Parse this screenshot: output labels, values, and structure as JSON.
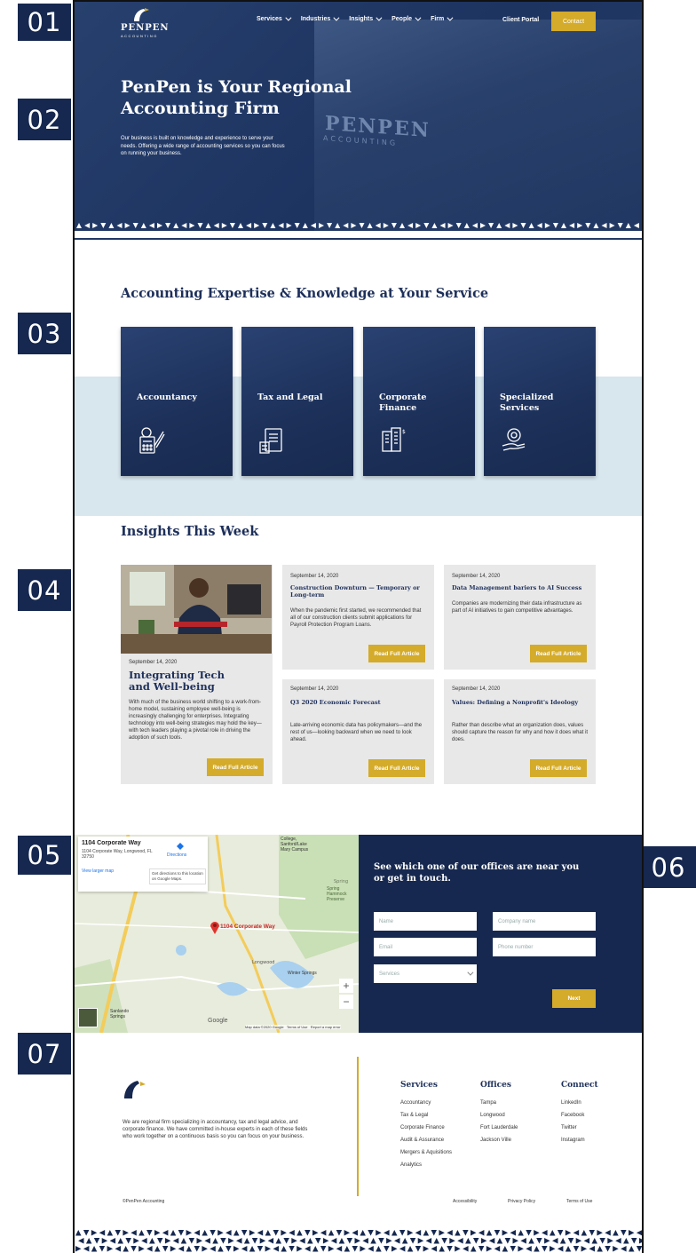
{
  "badges": {
    "b1": "01",
    "b2": "02",
    "b3": "03",
    "b4": "04",
    "b5": "05",
    "b6": "06",
    "b7": "07"
  },
  "brand": {
    "name": "PENPEN",
    "sub": "ACCOUNTING",
    "accent": "#d4ab2a",
    "navy": "#16284f"
  },
  "nav": {
    "items": [
      "Services",
      "Industries",
      "Insights",
      "People",
      "Firm"
    ],
    "portal": "Client Portal",
    "contact": "Contact"
  },
  "hero": {
    "title": "PenPen is Your Regional Accounting Firm",
    "text": "Our business is built on knowledge and experience to serve your needs. Offering a wide range of accounting services so you can focus on running your business.",
    "sign": "PENPEN",
    "sign_sub": "ACCOUNTING"
  },
  "expertise": {
    "title": "Accounting Expertise & Knowledge at Your Service",
    "cards": [
      {
        "label": "Accountancy",
        "icon": "calculator-icon"
      },
      {
        "label": "Tax and Legal",
        "icon": "tax-document-icon"
      },
      {
        "label": "Corporate Finance",
        "icon": "building-finance-icon"
      },
      {
        "label": "Specialized Services",
        "icon": "hand-gear-icon"
      }
    ]
  },
  "insights": {
    "title": "Insights This Week",
    "featured": {
      "date": "September 14, 2020",
      "title": "Integrating Tech and Well-being",
      "body": "With much of the business world shifting to a work-from-home model, sustaining employee well-being is increasingly challenging for enterprises. Integrating technology into well-being strategies may hold the key—with tech leaders playing a pivotal role in driving the adoption of such tools.",
      "button": "Read Full Article"
    },
    "articles": [
      {
        "date": "September 14, 2020",
        "title": "Construction Downturn — Temporary or Long-term",
        "body": "When the pandemic first started, we recommended that all of our construction clients submit applications for Payroll Protection Program Loans.",
        "button": "Read Full Article"
      },
      {
        "date": "September 14, 2020",
        "title": "Data Management bariers to AI Success",
        "body": "Companies are modernizing their data infrastructure as part of AI initiatives to gain competitive advantages.",
        "button": "Read Full Article"
      },
      {
        "date": "September 14, 2020",
        "title": "Q3 2020 Economic Forecast",
        "body": "Late-arriving economic data has policymakers—and the rest of us—looking backward when we need to look ahead.",
        "button": "Read Full Article"
      },
      {
        "date": "September 14, 2020",
        "title": "Values: Defining a Nonprofit's Ideology",
        "body": "Rather than describe what an organization does, values should capture the reason for why and how it does what it does.",
        "button": "Read Full Article"
      }
    ]
  },
  "map": {
    "place": "1104 Corporate Way",
    "address": "1104 Corporate Way, Longwood, FL 32750",
    "directions": "Directions",
    "larger": "View larger map",
    "hint": "Get directions to this location on Google Maps.",
    "pin_label": "1104 Corporate Way",
    "labels": {
      "college": "College, Sanford/Lake Mary Campus",
      "spring": "Spring Hammock Preserve",
      "longwood": "Longwood",
      "winter": "Winter Springs",
      "sanlando": "Sanlando Springs"
    },
    "attribution": "Map data ©2020 Google   Terms of Use   Report a map error",
    "google": "Google",
    "zoom_in": "+",
    "zoom_out": "−"
  },
  "form": {
    "title": "See which one of our offices are near you or get in touch.",
    "name": "Name",
    "company": "Company name",
    "email": "Email",
    "phone": "Phone number",
    "services": "Services",
    "next": "Next"
  },
  "footer": {
    "desc": "We are regional firm specializing in accountancy, tax and legal advice, and corporate finance. We have committed in-house experts in each of these fields who work together on a continuous basis so you can focus on your business.",
    "services": {
      "title": "Services",
      "items": [
        "Accountancy",
        "Tax & Legal",
        "Corporate Finance",
        "Audit & Assurance",
        "Mergers & Aquisitions",
        "Analytics"
      ]
    },
    "offices": {
      "title": "Offices",
      "items": [
        "Tampa",
        "Longwood",
        "Fort Lauderdale",
        "Jackson Ville"
      ]
    },
    "connect": {
      "title": "Connect",
      "items": [
        "LinkedIn",
        "Facebook",
        "Twitter",
        "Instagram"
      ]
    },
    "copyright": "©PenPen Accounting",
    "accessibility": "Accessibility",
    "privacy": "Privacy Policy",
    "terms": "Terms of Use"
  }
}
